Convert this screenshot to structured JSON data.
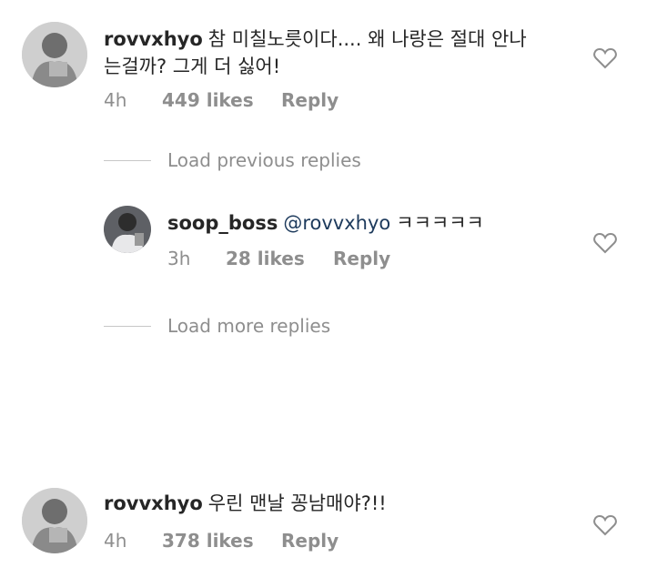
{
  "comments": [
    {
      "username": "rovvxhyo",
      "text_line1": "참 미칠노릇이다.... 왜 나랑은 절대 안나",
      "text_line2": "는걸까?  그게 더 싫어!",
      "time": "4h",
      "likes": "449 likes",
      "reply_label": "Reply",
      "like_icon": "heart-outline-icon"
    },
    {
      "username": "rovvxhyo",
      "text": "우린 맨날 꽁남매야?!!",
      "time": "4h",
      "likes": "378 likes",
      "reply_label": "Reply",
      "like_icon": "heart-outline-icon"
    }
  ],
  "reply": {
    "username": "soop_boss",
    "mention": "@rovvxhyo",
    "text": "ㅋㅋㅋㅋㅋ",
    "time": "3h",
    "likes": "28 likes",
    "reply_label": "Reply",
    "like_icon": "heart-outline-icon"
  },
  "load_previous": "Load previous replies",
  "load_more": "Load more replies",
  "colors": {
    "text": "#262626",
    "secondary": "#8e8e8e",
    "mention": "#1d3a5c",
    "divider": "#c7c7c7"
  }
}
